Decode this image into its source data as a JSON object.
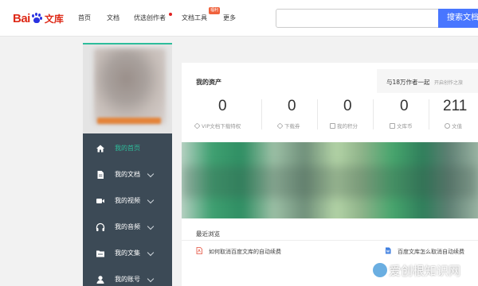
{
  "header": {
    "logo_bai": "Bai",
    "logo_du": "du",
    "logo_wenku": "文库",
    "nav": [
      {
        "label": "首页",
        "has_dot": false
      },
      {
        "label": "文档",
        "has_dot": false
      },
      {
        "label": "优选创作者",
        "has_dot": true
      },
      {
        "label": "文档工具",
        "has_dot": false,
        "badge": "福利"
      },
      {
        "label": "更多",
        "has_dot": false
      }
    ],
    "search": {
      "placeholder": "",
      "button_label": "搜索文档"
    }
  },
  "sidebar": {
    "items": [
      {
        "label": "我的首页",
        "icon": "home-icon",
        "active": true,
        "has_chevron": false
      },
      {
        "label": "我的文档",
        "icon": "document-icon",
        "active": false,
        "has_chevron": true
      },
      {
        "label": "我的视频",
        "icon": "video-icon",
        "active": false,
        "has_chevron": true
      },
      {
        "label": "我的音频",
        "icon": "headphones-icon",
        "active": false,
        "has_chevron": true
      },
      {
        "label": "我的文集",
        "icon": "folder-icon",
        "active": false,
        "has_chevron": true
      },
      {
        "label": "我的账号",
        "icon": "user-icon",
        "active": false,
        "has_chevron": true
      }
    ]
  },
  "assets": {
    "title": "我的资产",
    "promo_text": "与18万作者一起",
    "promo_link": "开启创作之旅",
    "stats": [
      {
        "value": "0",
        "label": "VIP文档下载特权",
        "icon": "diamond-icon"
      },
      {
        "value": "0",
        "label": "下载券",
        "icon": "ticket-icon"
      },
      {
        "value": "0",
        "label": "我的积分",
        "icon": "points-icon"
      },
      {
        "value": "0",
        "label": "文库币",
        "icon": "coin-icon"
      },
      {
        "value": "211",
        "label": "文值",
        "icon": "value-icon"
      }
    ]
  },
  "recent": {
    "title": "最近浏览",
    "docs": [
      {
        "title": "如何取消百度文库的自动续费",
        "icon": "pdf-icon"
      },
      {
        "title": "百度文库怎么取消自动续费",
        "icon": "word-icon"
      }
    ]
  },
  "watermark": {
    "text": "爱创根知识网"
  },
  "colors": {
    "brand_red": "#de2a18",
    "accent_green": "#2dbd9b",
    "sidebar_bg": "#3c4a56",
    "search_blue": "#4876ff"
  }
}
